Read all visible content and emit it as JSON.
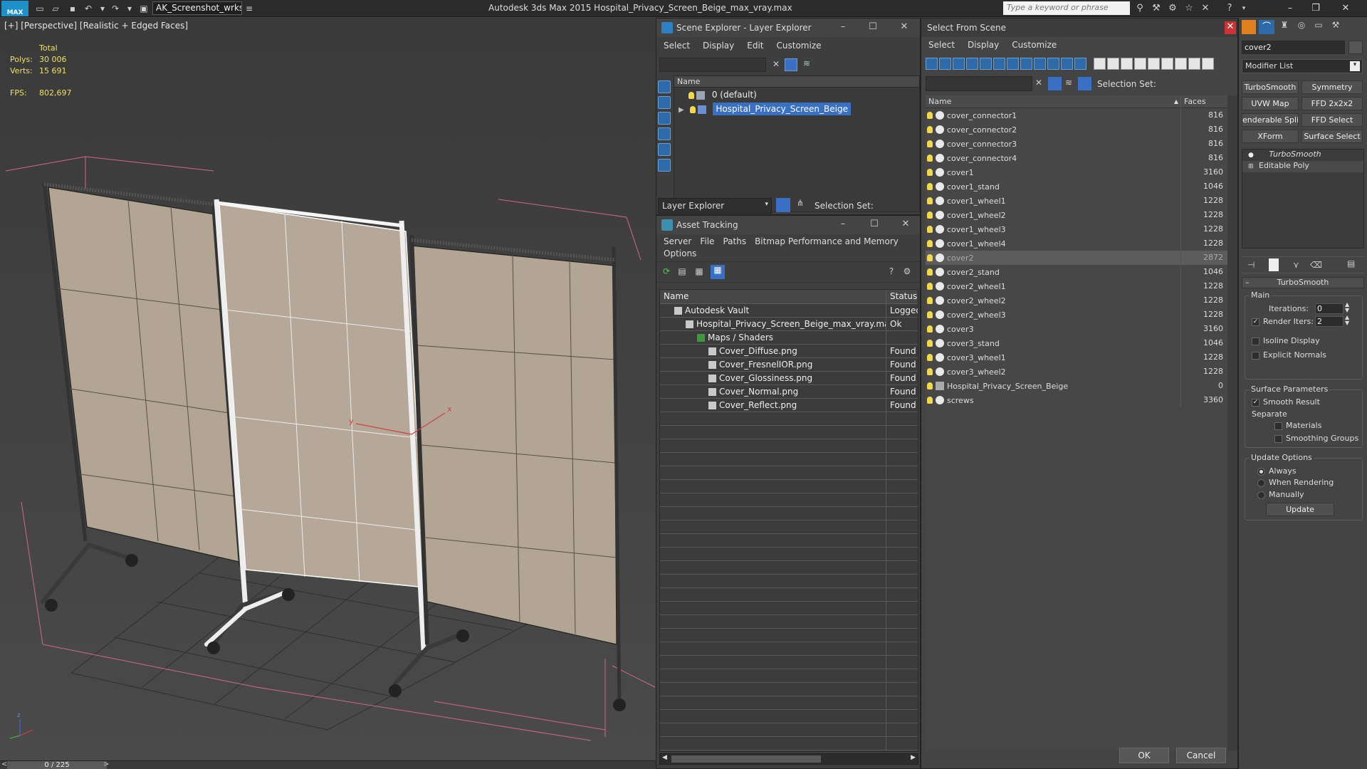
{
  "titlebar": {
    "logo": "MAX",
    "workspace": "AK_Screenshot_wrksp",
    "app_title": "Autodesk 3ds Max  2015    Hospital_Privacy_Screen_Beige_max_vray.max",
    "search_placeholder": "Type a keyword or phrase"
  },
  "viewport": {
    "label": "[+] [Perspective] [Realistic + Edged Faces]",
    "stats_header": "Total",
    "polys_label": "Polys:",
    "polys": "30 006",
    "verts_label": "Verts:",
    "verts": "15 691",
    "fps_label": "FPS:",
    "fps": "802,697",
    "time_slider": "0 / 225",
    "gizmo_x": "x",
    "gizmo_y": "y",
    "axis_z": "z"
  },
  "scene_explorer": {
    "title": "Scene Explorer - Layer Explorer",
    "menus": [
      "Select",
      "Display",
      "Edit",
      "Customize"
    ],
    "column_name": "Name",
    "layers": [
      {
        "name": "0 (default)",
        "selected": false
      },
      {
        "name": "Hospital_Privacy_Screen_Beige",
        "selected": true
      }
    ],
    "explorer_dropdown": "Layer Explorer",
    "selection_set_label": "Selection Set:"
  },
  "asset_tracking": {
    "title": "Asset Tracking",
    "menus": [
      "Server",
      "File",
      "Paths",
      "Bitmap Performance and Memory"
    ],
    "menu_options": "Options",
    "col_name": "Name",
    "col_status": "Status",
    "rows": [
      {
        "name": "Autodesk Vault",
        "status": "Logged",
        "indent": 1,
        "icon": "vault-icon"
      },
      {
        "name": "Hospital_Privacy_Screen_Beige_max_vray.max",
        "status": "Ok",
        "indent": 2,
        "icon": "max-file-icon"
      },
      {
        "name": "Maps / Shaders",
        "status": "",
        "indent": 3,
        "icon": "maps-icon"
      },
      {
        "name": "Cover_Diffuse.png",
        "status": "Found",
        "indent": 4,
        "icon": "image-file-icon"
      },
      {
        "name": "Cover_FresnelIOR.png",
        "status": "Found",
        "indent": 4,
        "icon": "image-file-icon"
      },
      {
        "name": "Cover_Glossiness.png",
        "status": "Found",
        "indent": 4,
        "icon": "image-file-icon"
      },
      {
        "name": "Cover_Normal.png",
        "status": "Found",
        "indent": 4,
        "icon": "image-file-icon"
      },
      {
        "name": "Cover_Reflect.png",
        "status": "Found",
        "indent": 4,
        "icon": "image-file-icon"
      }
    ]
  },
  "select_from_scene": {
    "title": "Select From Scene",
    "menus": [
      "Select",
      "Display",
      "Customize"
    ],
    "selection_set_label": "Selection Set:",
    "col_name": "Name",
    "col_faces": "Faces",
    "objects": [
      {
        "name": "cover_connector1",
        "faces": "816"
      },
      {
        "name": "cover_connector2",
        "faces": "816"
      },
      {
        "name": "cover_connector3",
        "faces": "816"
      },
      {
        "name": "cover_connector4",
        "faces": "816"
      },
      {
        "name": "cover1",
        "faces": "3160"
      },
      {
        "name": "cover1_stand",
        "faces": "1046"
      },
      {
        "name": "cover1_wheel1",
        "faces": "1228"
      },
      {
        "name": "cover1_wheel2",
        "faces": "1228"
      },
      {
        "name": "cover1_wheel3",
        "faces": "1228"
      },
      {
        "name": "cover1_wheel4",
        "faces": "1228"
      },
      {
        "name": "cover2",
        "faces": "2872",
        "selected": true
      },
      {
        "name": "cover2_stand",
        "faces": "1046"
      },
      {
        "name": "cover2_wheel1",
        "faces": "1228"
      },
      {
        "name": "cover2_wheel2",
        "faces": "1228"
      },
      {
        "name": "cover2_wheel3",
        "faces": "1228"
      },
      {
        "name": "cover3",
        "faces": "3160"
      },
      {
        "name": "cover3_stand",
        "faces": "1046"
      },
      {
        "name": "cover3_wheel1",
        "faces": "1228"
      },
      {
        "name": "cover3_wheel2",
        "faces": "1228"
      },
      {
        "name": "Hospital_Privacy_Screen_Beige",
        "faces": "0",
        "group": true
      },
      {
        "name": "screws",
        "faces": "3360"
      }
    ],
    "ok": "OK",
    "cancel": "Cancel"
  },
  "command_panel": {
    "object_name": "cover2",
    "modifier_list": "Modifier List",
    "buttons": [
      "TurboSmooth",
      "Symmetry",
      "UVW Map",
      "FFD 2x2x2",
      "enderable Splin",
      "FFD Select",
      "XForm",
      "Surface Select"
    ],
    "stack": [
      "TurboSmooth",
      "Editable Poly"
    ],
    "rollout_title": "TurboSmooth",
    "main_label": "Main",
    "iterations_label": "Iterations:",
    "iterations": "0",
    "render_iters_label": "Render Iters:",
    "render_iters": "2",
    "isoline_label": "Isoline Display",
    "explicit_normals_label": "Explicit Normals",
    "surface_params_label": "Surface Parameters",
    "smooth_result_label": "Smooth Result",
    "separate_label": "Separate",
    "materials_label": "Materials",
    "smoothing_groups_label": "Smoothing Groups",
    "update_options_label": "Update Options",
    "always_label": "Always",
    "when_rendering_label": "When Rendering",
    "manually_label": "Manually",
    "update_button": "Update"
  },
  "colors": {
    "accent": "#3a70c4",
    "stats": "#f0e060",
    "panel": "#444444",
    "cloth": "#b5a797"
  }
}
